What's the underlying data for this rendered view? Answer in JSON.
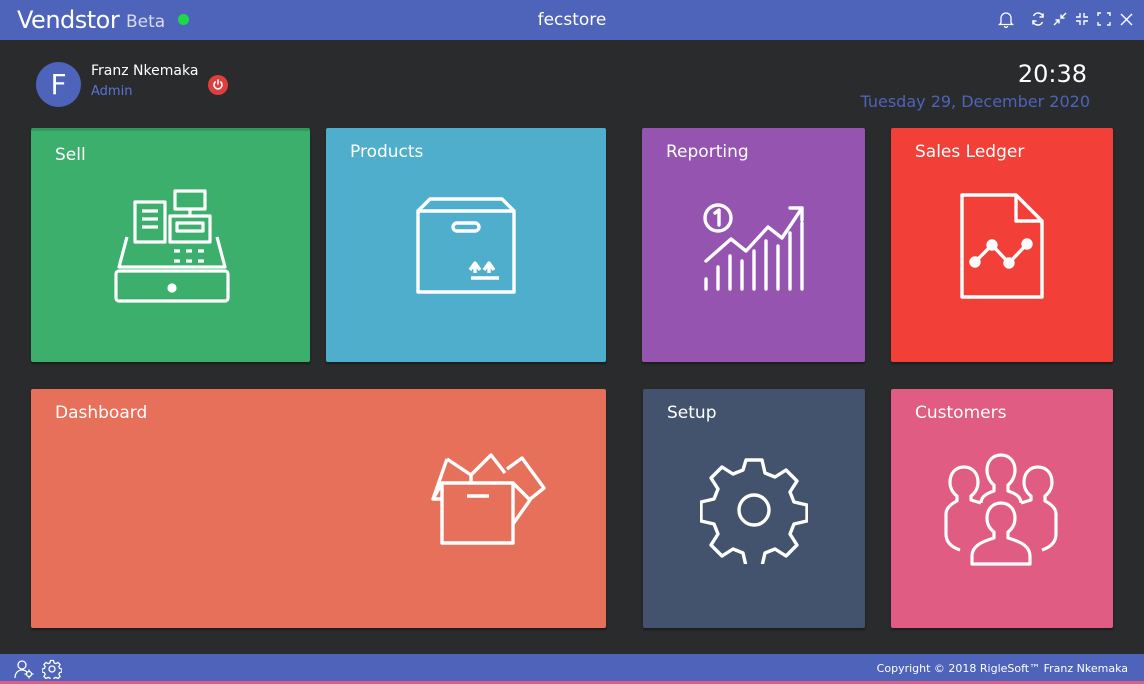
{
  "app": {
    "name": "Vendstor",
    "badge": "Beta",
    "store_name": "fecstore",
    "status_color": "#1fd84a"
  },
  "window_controls": [
    "bell-icon",
    "refresh-icon",
    "minimize-icon",
    "compact-icon",
    "maximize-icon",
    "close-icon"
  ],
  "user": {
    "initial": "F",
    "name": "Franz Nkemaka",
    "role": "Admin"
  },
  "clock": {
    "time": "20:38",
    "date": "Tuesday 29, December  2020"
  },
  "tiles": {
    "sell": {
      "label": "Sell",
      "color": "#3daf6c",
      "icon": "cash-register-icon"
    },
    "products": {
      "label": "Products",
      "color": "#4faecb",
      "icon": "box-icon"
    },
    "reporting": {
      "label": "Reporting",
      "color": "#9454b0",
      "icon": "growth-chart-icon"
    },
    "ledger": {
      "label": "Sales Ledger",
      "color": "#f23f37",
      "icon": "document-chart-icon"
    },
    "dashboard": {
      "label": "Dashboard",
      "color": "#e6705a",
      "icon": "open-box-icon"
    },
    "setup": {
      "label": "Setup",
      "color": "#43526d",
      "icon": "gear-icon"
    },
    "customers": {
      "label": "Customers",
      "color": "#e05c82",
      "icon": "people-icon"
    }
  },
  "footer": {
    "copyright": "Copyright © 2018 RigleSoft™ Franz Nkemaka",
    "icons": [
      "user-settings-icon",
      "settings-icon"
    ]
  }
}
